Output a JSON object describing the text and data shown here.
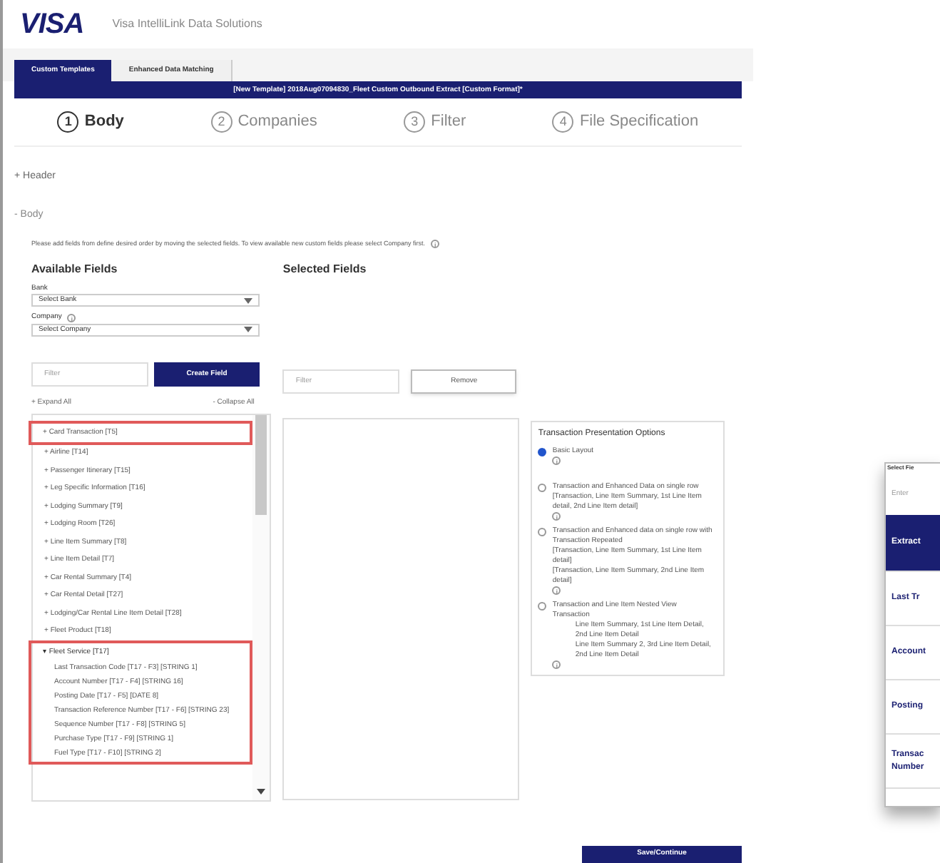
{
  "app": {
    "logo": "VISA",
    "title": "Visa IntelliLink Data Solutions"
  },
  "tabs": [
    {
      "label": "Custom Templates",
      "selected": true
    },
    {
      "label": "Enhanced Data Matching",
      "selected": false
    }
  ],
  "banner": "[New Template] 2018Aug07094830_Fleet Custom Outbound Extract [Custom Format]*",
  "steps": [
    {
      "number": "1",
      "label": "Body",
      "selected": true
    },
    {
      "number": "2",
      "label": "Companies",
      "selected": false
    },
    {
      "number": "3",
      "label": "Filter",
      "selected": false
    },
    {
      "number": "4",
      "label": "File Specification",
      "selected": false
    }
  ],
  "sections": [
    {
      "toggle": "+",
      "label": "Header",
      "expanded": false
    },
    {
      "toggle": "-",
      "label": "Body",
      "expanded": true
    }
  ],
  "instructions": "Please add fields from define desired order by moving the selected fields. To view available new custom fields please select Company first.",
  "instructions_info": "i",
  "available": {
    "title": "Available Fields",
    "bank_label": "Bank",
    "bank_value": "Select Bank",
    "company_label": "Company",
    "company_info": "i",
    "company_value": "Select Company",
    "filter_placeholder": "Filter",
    "create_button": "Create Field",
    "expand_all": "+ Expand All",
    "collapse_all": "- Collapse All",
    "groups": [
      {
        "toggle": "+",
        "label": "Card Transaction [T5]",
        "expanded": false,
        "highlighted": true
      },
      {
        "toggle": "+",
        "label": "Airline [T14]",
        "expanded": false,
        "highlighted": false
      },
      {
        "toggle": "+",
        "label": "Passenger Itinerary [T15]",
        "expanded": false,
        "highlighted": false
      },
      {
        "toggle": "+",
        "label": "Leg Specific Information [T16]",
        "expanded": false,
        "highlighted": false
      },
      {
        "toggle": "+",
        "label": "Lodging Summary [T9]",
        "expanded": false,
        "highlighted": false
      },
      {
        "toggle": "+",
        "label": "Lodging Room [T26]",
        "expanded": false,
        "highlighted": false
      },
      {
        "toggle": "+",
        "label": "Line Item Summary [T8]",
        "expanded": false,
        "highlighted": false
      },
      {
        "toggle": "+",
        "label": "Line Item Detail [T7]",
        "expanded": false,
        "highlighted": false
      },
      {
        "toggle": "+",
        "label": "Car Rental Summary [T4]",
        "expanded": false,
        "highlighted": false
      },
      {
        "toggle": "+",
        "label": "Car Rental Detail [T27]",
        "expanded": false,
        "highlighted": false
      },
      {
        "toggle": "+",
        "label": "Lodging/Car Rental Line Item Detail [T28]",
        "expanded": false,
        "highlighted": false
      },
      {
        "toggle": "+",
        "label": "Fleet Product [T18]",
        "expanded": false,
        "highlighted": false
      },
      {
        "toggle": "▾",
        "label": "Fleet Service [T17]",
        "expanded": true,
        "highlighted": true,
        "children": [
          {
            "label": "Last Transaction Code [T17 - F3] [STRING 1]"
          },
          {
            "label": "Account Number [T17 - F4] [STRING 16]"
          },
          {
            "label": "Posting Date [T17 - F5] [DATE 8]"
          },
          {
            "label": "Transaction Reference Number [T17 - F6] [STRING 23]"
          },
          {
            "label": "Sequence Number [T17 - F8] [STRING 5]"
          },
          {
            "label": "Purchase Type [T17 - F9] [STRING 1]"
          },
          {
            "label": "Fuel Type [T17 - F10] [STRING 2]"
          }
        ]
      }
    ]
  },
  "selected": {
    "title": "Selected Fields",
    "filter_placeholder": "Filter",
    "remove_button": "Remove"
  },
  "options": {
    "title": "Transaction Presentation Options",
    "items": [
      {
        "selected": true,
        "lines": [
          "Basic Layout"
        ],
        "info": "i"
      },
      {
        "selected": false,
        "lines": [
          "Transaction and Enhanced Data on single row",
          "[Transaction, Line Item Summary, 1st Line Item detail, 2nd Line Item detail]"
        ],
        "info": "i"
      },
      {
        "selected": false,
        "lines": [
          "Transaction and Enhanced data on single row with Transaction Repeated",
          "[Transaction, Line Item Summary, 1st Line Item detail]",
          "[Transaction, Line Item Summary, 2nd Line Item detail]"
        ],
        "info": "i"
      },
      {
        "selected": false,
        "lines": [
          "Transaction and Line Item Nested View",
          "Transaction",
          "Line Item Summary, 1st Line Item Detail, 2nd Line Item Detail",
          "Line Item Summary 2, 3rd Line Item Detail, 2nd Line Item Detail"
        ],
        "info": "i"
      }
    ]
  },
  "continue_button": "Save/Continue",
  "popup": {
    "title": "Select Fie",
    "placeholder": "Enter",
    "items": [
      {
        "label": "Extract",
        "selected": true
      },
      {
        "label": "Last Tr",
        "selected": false
      },
      {
        "label": "Account",
        "selected": false
      },
      {
        "label": "Posting",
        "selected": false
      },
      {
        "label": "Transac Number",
        "selected": false
      }
    ]
  }
}
